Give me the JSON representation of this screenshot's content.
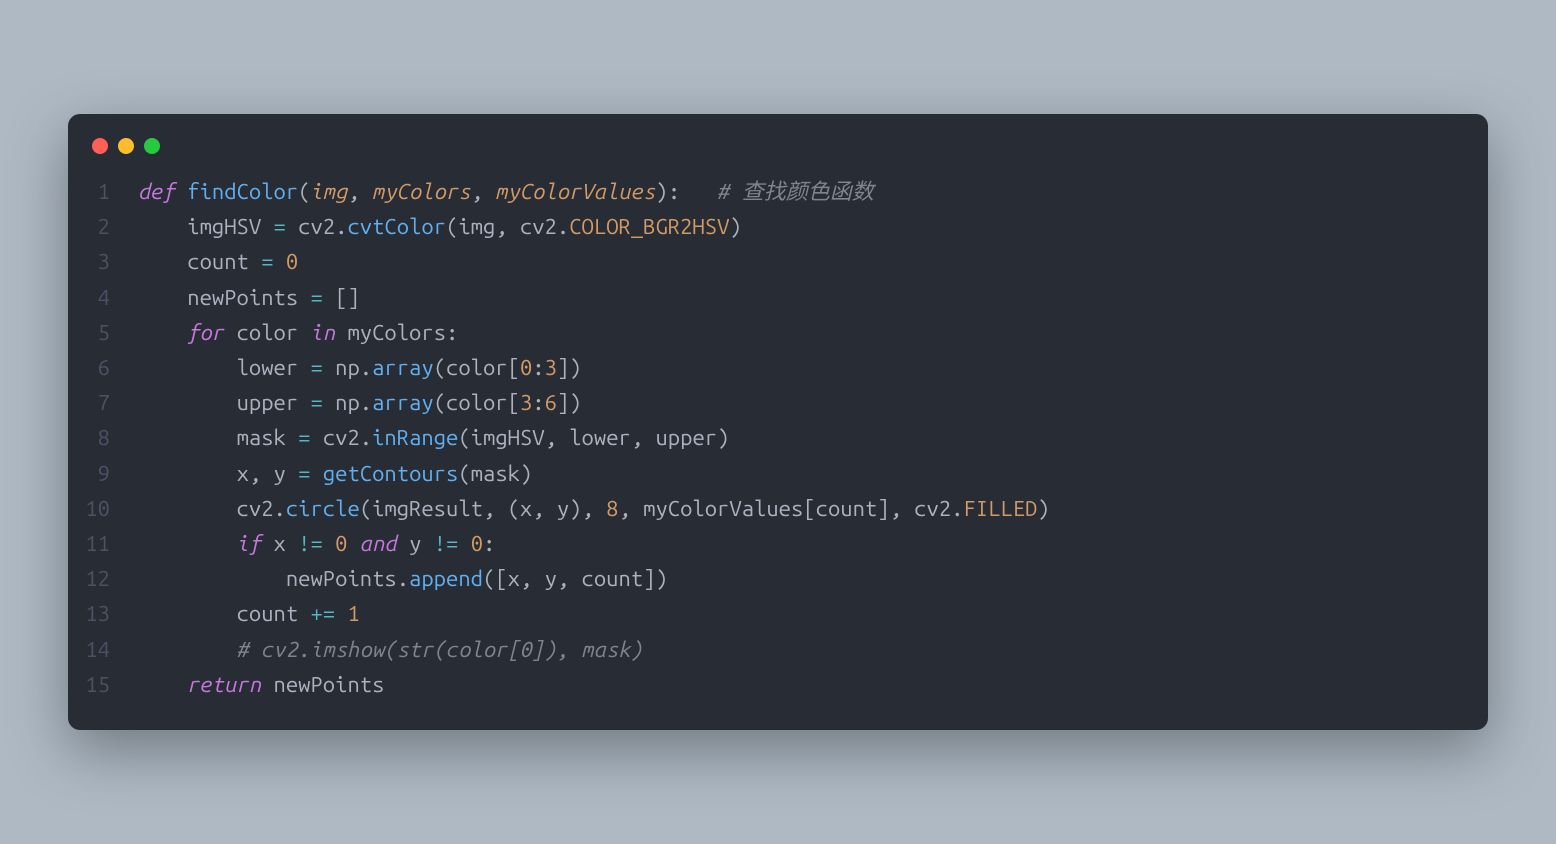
{
  "window": {
    "dots": [
      "red",
      "yellow",
      "green"
    ]
  },
  "code": {
    "lines": [
      {
        "n": "1",
        "tokens": [
          {
            "c": "kw",
            "t": "def"
          },
          {
            "c": "punct",
            "t": " "
          },
          {
            "c": "fn",
            "t": "findColor"
          },
          {
            "c": "punct",
            "t": "("
          },
          {
            "c": "param",
            "t": "img"
          },
          {
            "c": "punct",
            "t": ", "
          },
          {
            "c": "param",
            "t": "myColors"
          },
          {
            "c": "punct",
            "t": ", "
          },
          {
            "c": "param",
            "t": "myColorValues"
          },
          {
            "c": "punct",
            "t": "):   "
          },
          {
            "c": "comment",
            "t": "# 查找颜色函数"
          }
        ]
      },
      {
        "n": "2",
        "tokens": [
          {
            "c": "punct",
            "t": "    "
          },
          {
            "c": "ident",
            "t": "imgHSV "
          },
          {
            "c": "op",
            "t": "="
          },
          {
            "c": "punct",
            "t": " cv2"
          },
          {
            "c": "punct",
            "t": "."
          },
          {
            "c": "fn",
            "t": "cvtColor"
          },
          {
            "c": "punct",
            "t": "(img, cv2."
          },
          {
            "c": "const",
            "t": "COLOR_BGR2HSV"
          },
          {
            "c": "punct",
            "t": ")"
          }
        ]
      },
      {
        "n": "3",
        "tokens": [
          {
            "c": "punct",
            "t": "    "
          },
          {
            "c": "ident",
            "t": "count "
          },
          {
            "c": "op",
            "t": "="
          },
          {
            "c": "punct",
            "t": " "
          },
          {
            "c": "num",
            "t": "0"
          }
        ]
      },
      {
        "n": "4",
        "tokens": [
          {
            "c": "punct",
            "t": "    "
          },
          {
            "c": "ident",
            "t": "newPoints "
          },
          {
            "c": "op",
            "t": "="
          },
          {
            "c": "punct",
            "t": " []"
          }
        ]
      },
      {
        "n": "5",
        "tokens": [
          {
            "c": "punct",
            "t": "    "
          },
          {
            "c": "kw",
            "t": "for"
          },
          {
            "c": "punct",
            "t": " color "
          },
          {
            "c": "kw",
            "t": "in"
          },
          {
            "c": "punct",
            "t": " myColors:"
          }
        ]
      },
      {
        "n": "6",
        "tokens": [
          {
            "c": "punct",
            "t": "        "
          },
          {
            "c": "ident",
            "t": "lower "
          },
          {
            "c": "op",
            "t": "="
          },
          {
            "c": "punct",
            "t": " np."
          },
          {
            "c": "fn",
            "t": "array"
          },
          {
            "c": "punct",
            "t": "(color["
          },
          {
            "c": "num",
            "t": "0"
          },
          {
            "c": "punct",
            "t": ":"
          },
          {
            "c": "num",
            "t": "3"
          },
          {
            "c": "punct",
            "t": "])"
          }
        ]
      },
      {
        "n": "7",
        "tokens": [
          {
            "c": "punct",
            "t": "        "
          },
          {
            "c": "ident",
            "t": "upper "
          },
          {
            "c": "op",
            "t": "="
          },
          {
            "c": "punct",
            "t": " np."
          },
          {
            "c": "fn",
            "t": "array"
          },
          {
            "c": "punct",
            "t": "(color["
          },
          {
            "c": "num",
            "t": "3"
          },
          {
            "c": "punct",
            "t": ":"
          },
          {
            "c": "num",
            "t": "6"
          },
          {
            "c": "punct",
            "t": "])"
          }
        ]
      },
      {
        "n": "8",
        "tokens": [
          {
            "c": "punct",
            "t": "        "
          },
          {
            "c": "ident",
            "t": "mask "
          },
          {
            "c": "op",
            "t": "="
          },
          {
            "c": "punct",
            "t": " cv2."
          },
          {
            "c": "fn",
            "t": "inRange"
          },
          {
            "c": "punct",
            "t": "(imgHSV, lower, upper)"
          }
        ]
      },
      {
        "n": "9",
        "tokens": [
          {
            "c": "punct",
            "t": "        "
          },
          {
            "c": "ident",
            "t": "x, y "
          },
          {
            "c": "op",
            "t": "="
          },
          {
            "c": "punct",
            "t": " "
          },
          {
            "c": "fn",
            "t": "getContours"
          },
          {
            "c": "punct",
            "t": "(mask)"
          }
        ]
      },
      {
        "n": "10",
        "tokens": [
          {
            "c": "punct",
            "t": "        cv2."
          },
          {
            "c": "fn",
            "t": "circle"
          },
          {
            "c": "punct",
            "t": "(imgResult, (x, y), "
          },
          {
            "c": "num",
            "t": "8"
          },
          {
            "c": "punct",
            "t": ", myColorValues[count], cv2."
          },
          {
            "c": "const",
            "t": "FILLED"
          },
          {
            "c": "punct",
            "t": ")"
          }
        ]
      },
      {
        "n": "11",
        "tokens": [
          {
            "c": "punct",
            "t": "        "
          },
          {
            "c": "kw",
            "t": "if"
          },
          {
            "c": "punct",
            "t": " x "
          },
          {
            "c": "op",
            "t": "!="
          },
          {
            "c": "punct",
            "t": " "
          },
          {
            "c": "num",
            "t": "0"
          },
          {
            "c": "punct",
            "t": " "
          },
          {
            "c": "kw",
            "t": "and"
          },
          {
            "c": "punct",
            "t": " y "
          },
          {
            "c": "op",
            "t": "!="
          },
          {
            "c": "punct",
            "t": " "
          },
          {
            "c": "num",
            "t": "0"
          },
          {
            "c": "punct",
            "t": ":"
          }
        ]
      },
      {
        "n": "12",
        "tokens": [
          {
            "c": "punct",
            "t": "            newPoints."
          },
          {
            "c": "fn",
            "t": "append"
          },
          {
            "c": "punct",
            "t": "([x, y, count])"
          }
        ]
      },
      {
        "n": "13",
        "tokens": [
          {
            "c": "punct",
            "t": "        "
          },
          {
            "c": "ident",
            "t": "count "
          },
          {
            "c": "op",
            "t": "+="
          },
          {
            "c": "punct",
            "t": " "
          },
          {
            "c": "num",
            "t": "1"
          }
        ]
      },
      {
        "n": "14",
        "tokens": [
          {
            "c": "punct",
            "t": "        "
          },
          {
            "c": "comment",
            "t": "# cv2.imshow(str(color[0]), mask)"
          }
        ]
      },
      {
        "n": "15",
        "tokens": [
          {
            "c": "punct",
            "t": "    "
          },
          {
            "c": "kw",
            "t": "return"
          },
          {
            "c": "punct",
            "t": " newPoints"
          }
        ]
      }
    ]
  }
}
